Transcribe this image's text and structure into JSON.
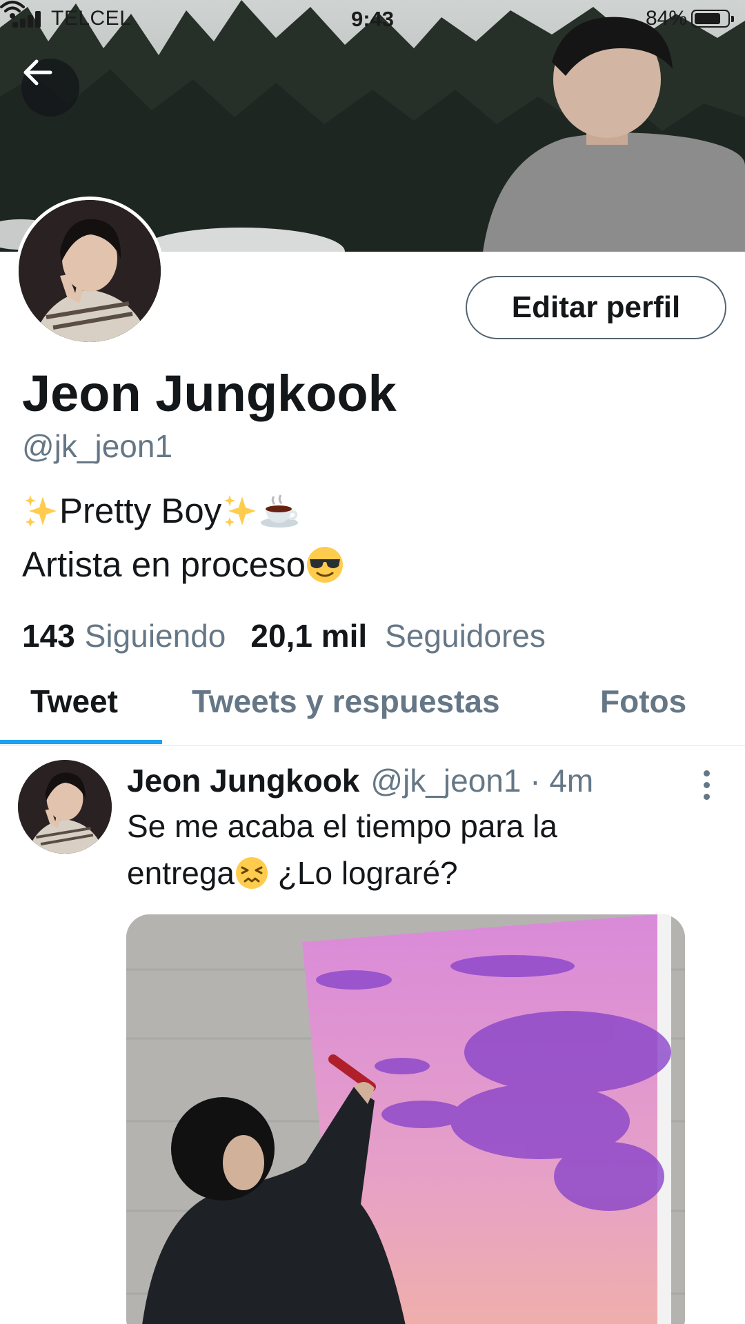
{
  "status_bar": {
    "carrier": "TELCEL",
    "time": "9:43",
    "battery": "84%",
    "battery_level": 0.84
  },
  "profile": {
    "display_name": "Jeon Jungkook",
    "username": "@jk_jeon1",
    "edit_button": "Editar perfil",
    "bio_line1": "Pretty Boy",
    "bio_line2": "Artista en proceso",
    "following_count": "143",
    "following_label": "Siguiendo",
    "followers_count": "20,1 mil",
    "followers_label": "Seguidores"
  },
  "tabs": [
    {
      "label": "Tweet",
      "active": true
    },
    {
      "label": "Tweets y respuestas",
      "active": false
    },
    {
      "label": "Fotos",
      "active": false
    }
  ],
  "tweet": {
    "name": "Jeon Jungkook",
    "handle_time": "@jk_jeon1 · 4m",
    "text_line1": "Se me acaba el tiempo para la",
    "text_line2a": "entrega",
    "text_line2b": " ¿Lo lograré?"
  },
  "icons": {
    "back": "arrow-left-icon",
    "more": "more-vertical-icon",
    "sparkles": "sparkles-emoji",
    "coffee": "hot-beverage-emoji",
    "sunglasses": "sunglasses-emoji",
    "persevering": "persevering-face-emoji"
  },
  "colors": {
    "accent": "#1da1f2",
    "secondary_text": "#657786",
    "primary_text": "#14171a"
  }
}
